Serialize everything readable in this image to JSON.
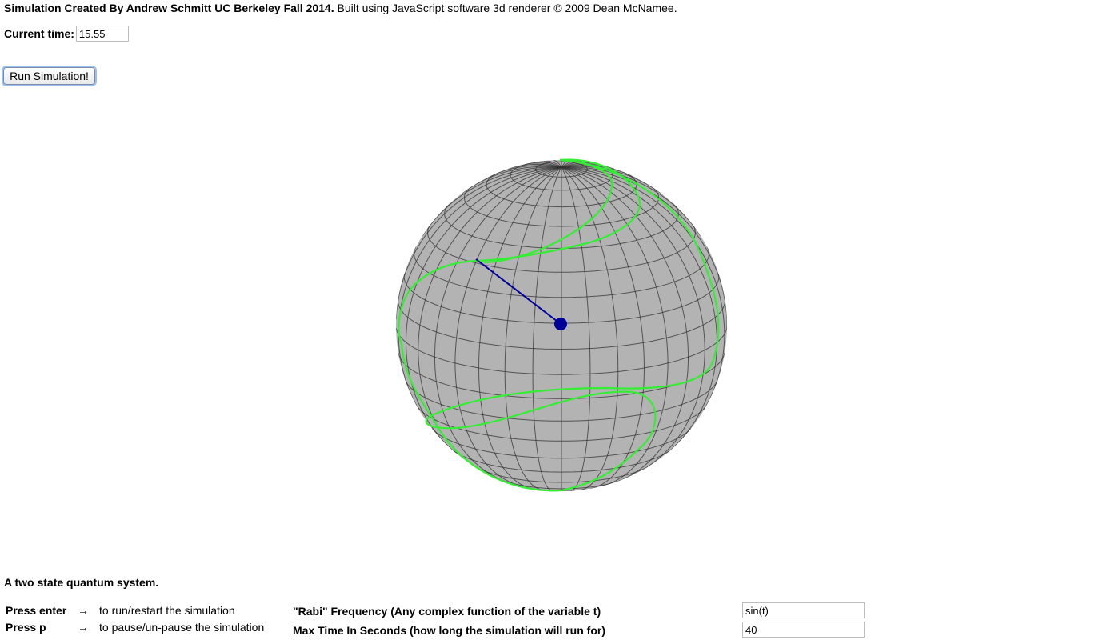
{
  "header": {
    "credit_bold": "Simulation Created By Andrew Schmitt UC Berkeley Fall 2014.",
    "credit_rest": " Built using JavaScript software 3d renderer  © 2009 Dean McNamee."
  },
  "time": {
    "label": "Current time:",
    "value": "15.55"
  },
  "controls": {
    "run_label": "Run Simulation!"
  },
  "scene": {
    "sphere_color": "#b3b3b3",
    "grid_color": "#333333",
    "trajectory_color": "#33ee33",
    "vector_color": "#000099"
  },
  "description": "A two state quantum system.",
  "keys": [
    {
      "key": "Press enter",
      "arrow": "→",
      "desc": "to run/restart the simulation"
    },
    {
      "key": "Press p",
      "arrow": "→",
      "desc": "to pause/un-pause the simulation"
    }
  ],
  "params": [
    {
      "label": "\"Rabi\" Frequency (Any complex function of the variable t)",
      "value": "sin(t)"
    },
    {
      "label": "Max Time In Seconds (how long the simulation will run for)",
      "value": "40"
    }
  ]
}
